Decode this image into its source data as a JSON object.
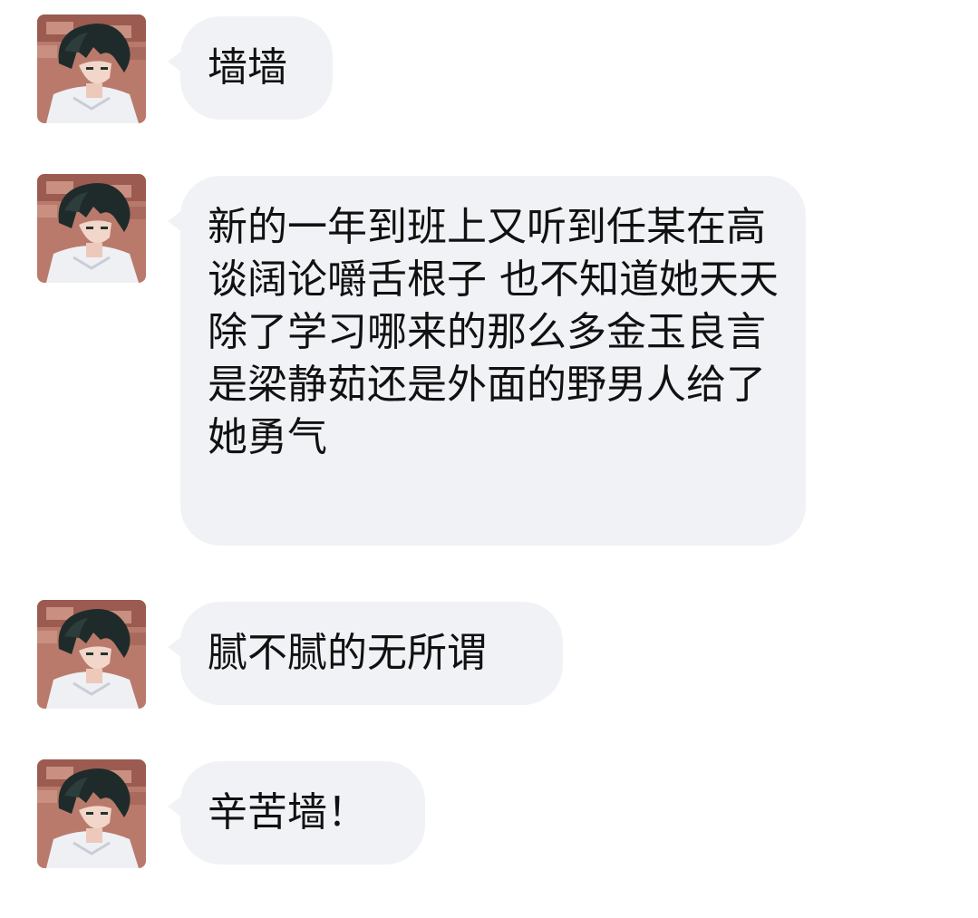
{
  "chat": {
    "messages": [
      {
        "text": "墙墙",
        "avatar_icon": "user-avatar"
      },
      {
        "text": "新的一年到班上又听到任某在高谈阔论嚼舌根子 也不知道她天天除了学习哪来的那么多金玉良言 是梁静茹还是外面的野男人给了她勇气",
        "avatar_icon": "user-avatar"
      },
      {
        "text": "腻不腻的无所谓",
        "avatar_icon": "user-avatar"
      },
      {
        "text": "辛苦墙！",
        "avatar_icon": "user-avatar"
      }
    ]
  },
  "colors": {
    "bubble": "#f1f2f6",
    "text": "#111111",
    "background": "#ffffff"
  }
}
